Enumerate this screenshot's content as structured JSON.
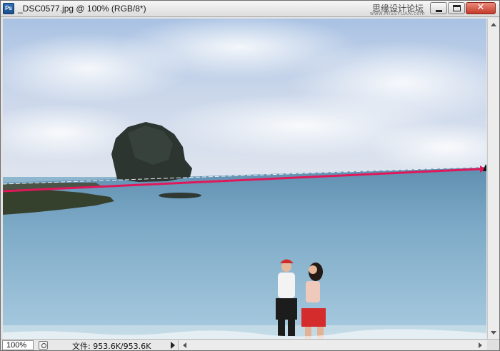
{
  "window": {
    "app_icon": "Ps",
    "title": "_DSC0577.jpg @ 100% (RGB/8*)",
    "watermark": "思缘设计论坛",
    "watermark_url": "www.MISSYUAN.com",
    "minimize_icon": "minimize-icon",
    "maximize_icon": "maximize-icon",
    "close_glyph": "✕"
  },
  "canvas": {
    "image_description_icon": "photo-canvas",
    "guide_line_color": "#e0185a"
  },
  "status": {
    "zoom": "100%",
    "file_info": "文件: 953.6K/953.6K"
  }
}
